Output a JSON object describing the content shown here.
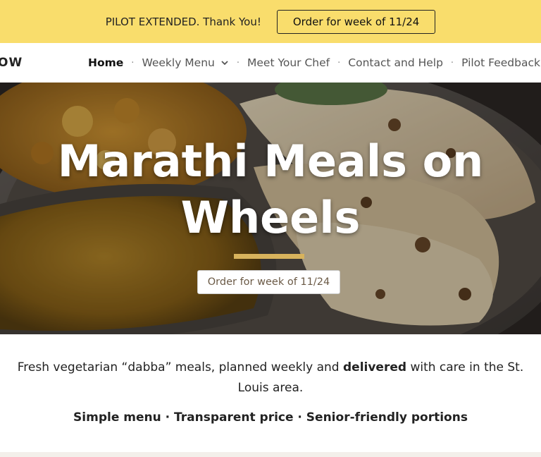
{
  "announcement": {
    "text": "PILOT EXTENDED. Thank You!",
    "button_label": "Order for week of 11/24",
    "background": "#f9dd6c"
  },
  "header": {
    "logo_text": "OW",
    "nav": [
      {
        "label": "Home",
        "active": true,
        "dropdown": false
      },
      {
        "label": "Weekly Menu",
        "active": false,
        "dropdown": true
      },
      {
        "label": "Meet Your Chef",
        "active": false,
        "dropdown": false
      },
      {
        "label": "Contact and Help",
        "active": false,
        "dropdown": false
      },
      {
        "label": "Pilot Feedback",
        "active": false,
        "dropdown": true
      }
    ],
    "separator": "·"
  },
  "hero": {
    "title_line1": "Marathi Meals on",
    "title_line2": "Wheels",
    "button_label": "Order for week of 11/24",
    "accent_color": "#d8b35c"
  },
  "intro": {
    "text_before": "Fresh vegetarian “dabba” meals, planned weekly and ",
    "text_bold": "delivered",
    "text_after": " with care in the St. Louis area."
  },
  "features": "Simple menu · Transparent price · Senior-friendly portions"
}
